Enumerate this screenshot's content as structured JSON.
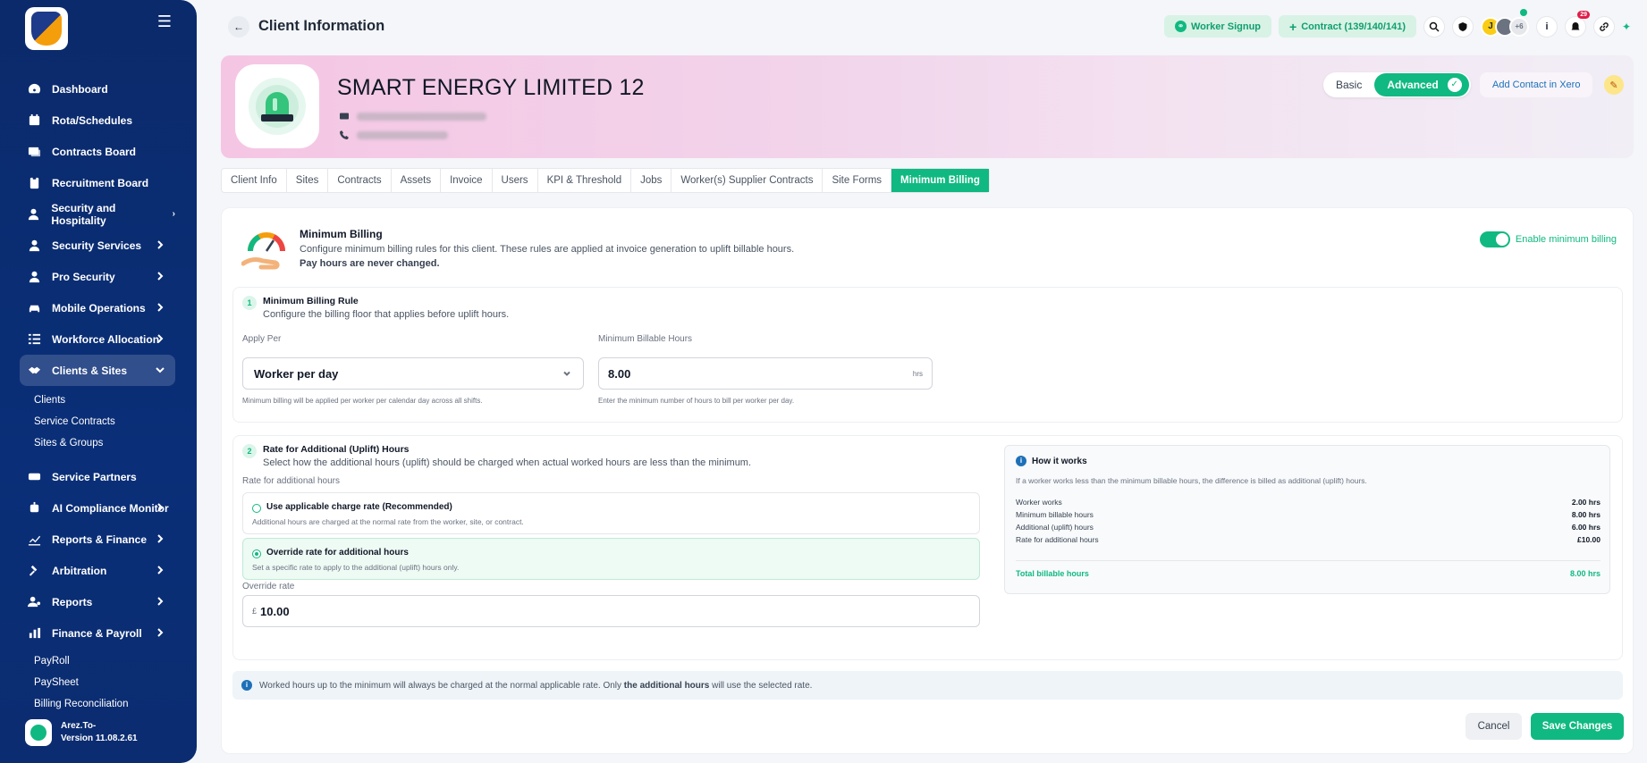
{
  "sidebar": {
    "items": [
      {
        "label": "Dashboard",
        "icon": "dashboard-icon",
        "chevron": false
      },
      {
        "label": "Rota/Schedules",
        "icon": "calendar-icon",
        "chevron": false
      },
      {
        "label": "Contracts Board",
        "icon": "contracts-icon",
        "chevron": false
      },
      {
        "label": "Recruitment Board",
        "icon": "recruitment-icon",
        "chevron": false
      },
      {
        "label": "Security and Hospitality",
        "icon": "user-icon",
        "chevron": true
      },
      {
        "label": "Security Services",
        "icon": "user-icon",
        "chevron": true
      },
      {
        "label": "Pro Security",
        "icon": "user-icon",
        "chevron": true
      },
      {
        "label": "Mobile Operations",
        "icon": "car-icon",
        "chevron": true
      },
      {
        "label": "Workforce Allocation",
        "icon": "list-icon",
        "chevron": true
      },
      {
        "label": "Clients & Sites",
        "icon": "handshake-icon",
        "chevron": true,
        "active": true
      }
    ],
    "clients_sub": [
      "Clients",
      "Service Contracts",
      "Sites & Groups"
    ],
    "items2": [
      {
        "label": "Service Partners",
        "icon": "partners-icon",
        "chevron": false
      },
      {
        "label": "AI Compliance Monitor",
        "icon": "robot-icon",
        "chevron": true
      },
      {
        "label": "Reports & Finance",
        "icon": "chart-icon",
        "chevron": true
      },
      {
        "label": "Arbitration",
        "icon": "gavel-icon",
        "chevron": true
      },
      {
        "label": "Reports",
        "icon": "user-gear-icon",
        "chevron": true
      },
      {
        "label": "Finance & Payroll",
        "icon": "bar-chart-icon",
        "chevron": true
      }
    ],
    "finance_sub": [
      "PayRoll",
      "PaySheet",
      "Billing Reconciliation"
    ],
    "footer": {
      "name": "Arez.To-",
      "version": "Version 11.08.2.61"
    }
  },
  "header": {
    "title": "Client Information",
    "worker_signup": "Worker Signup",
    "contract": "Contract (139/140/141)",
    "avatar_initial": "J",
    "avatar_more": "+6",
    "notif_count": "29"
  },
  "client": {
    "name": "SMART ENERGY LIMITED 12",
    "mode_basic": "Basic",
    "mode_advanced": "Advanced",
    "xero_label": "Add Contact in Xero"
  },
  "tabs": [
    {
      "label": "Client Info"
    },
    {
      "label": "Sites"
    },
    {
      "label": "Contracts"
    },
    {
      "label": "Assets"
    },
    {
      "label": "Invoice"
    },
    {
      "label": "Users"
    },
    {
      "label": "KPI & Threshold"
    },
    {
      "label": "Jobs"
    },
    {
      "label": "Worker(s) Supplier Contracts"
    },
    {
      "label": "Site Forms"
    },
    {
      "label": "Minimum Billing",
      "active": true
    }
  ],
  "min_billing": {
    "title": "Minimum Billing",
    "desc": "Configure minimum billing rules for this client. These rules are applied at invoice generation to uplift billable hours.",
    "desc_bold": "Pay hours are never changed.",
    "enable_label": "Enable minimum billing",
    "rule": {
      "step": "1",
      "title": "Minimum Billing Rule",
      "sub": "Configure the billing floor that applies before uplift hours.",
      "apply_per_label": "Apply Per",
      "apply_per_value": "Worker per day",
      "apply_per_help": "Minimum billing will be applied per worker per calendar day across all shifts.",
      "min_hours_label": "Minimum Billable Hours",
      "min_hours_value": "8.00",
      "min_hours_unit": "hrs",
      "min_hours_help": "Enter the minimum number of hours to bill per worker per day."
    },
    "rate": {
      "step": "2",
      "title": "Rate for Additional (Uplift) Hours",
      "sub": "Select how the additional hours (uplift) should be charged when actual worked hours are less than the minimum.",
      "group_label": "Rate for additional hours",
      "option1_title": "Use applicable charge rate (Recommended)",
      "option1_desc": "Additional hours are charged at the normal rate from the worker, site, or contract.",
      "option2_title": "Override rate for additional hours",
      "option2_desc": "Set a specific rate to apply to the additional (uplift) hours only.",
      "override_label": "Override rate",
      "currency": "£",
      "override_value": "10.00"
    },
    "how": {
      "title": "How it works",
      "desc": "If a worker works less than the minimum billable hours, the difference is billed as additional (uplift) hours.",
      "rows": [
        {
          "label": "Worker works",
          "value": "2.00 hrs"
        },
        {
          "label": "Minimum billable hours",
          "value": "8.00 hrs"
        },
        {
          "label": "Additional (uplift) hours",
          "value": "6.00 hrs"
        },
        {
          "label": "Rate for additional hours",
          "value": "£10.00"
        }
      ],
      "total_label": "Total billable hours",
      "total_value": "8.00 hrs"
    },
    "note_pre": "Worked hours up to the minimum will always be charged at the normal applicable rate. Only",
    "note_bold": "the additional hours",
    "note_post": "will use the selected rate.",
    "cancel": "Cancel",
    "save": "Save Changes"
  },
  "colors": {
    "accent": "#10b981",
    "sidebar": "#0b2a6b",
    "link": "#1d70b8"
  }
}
